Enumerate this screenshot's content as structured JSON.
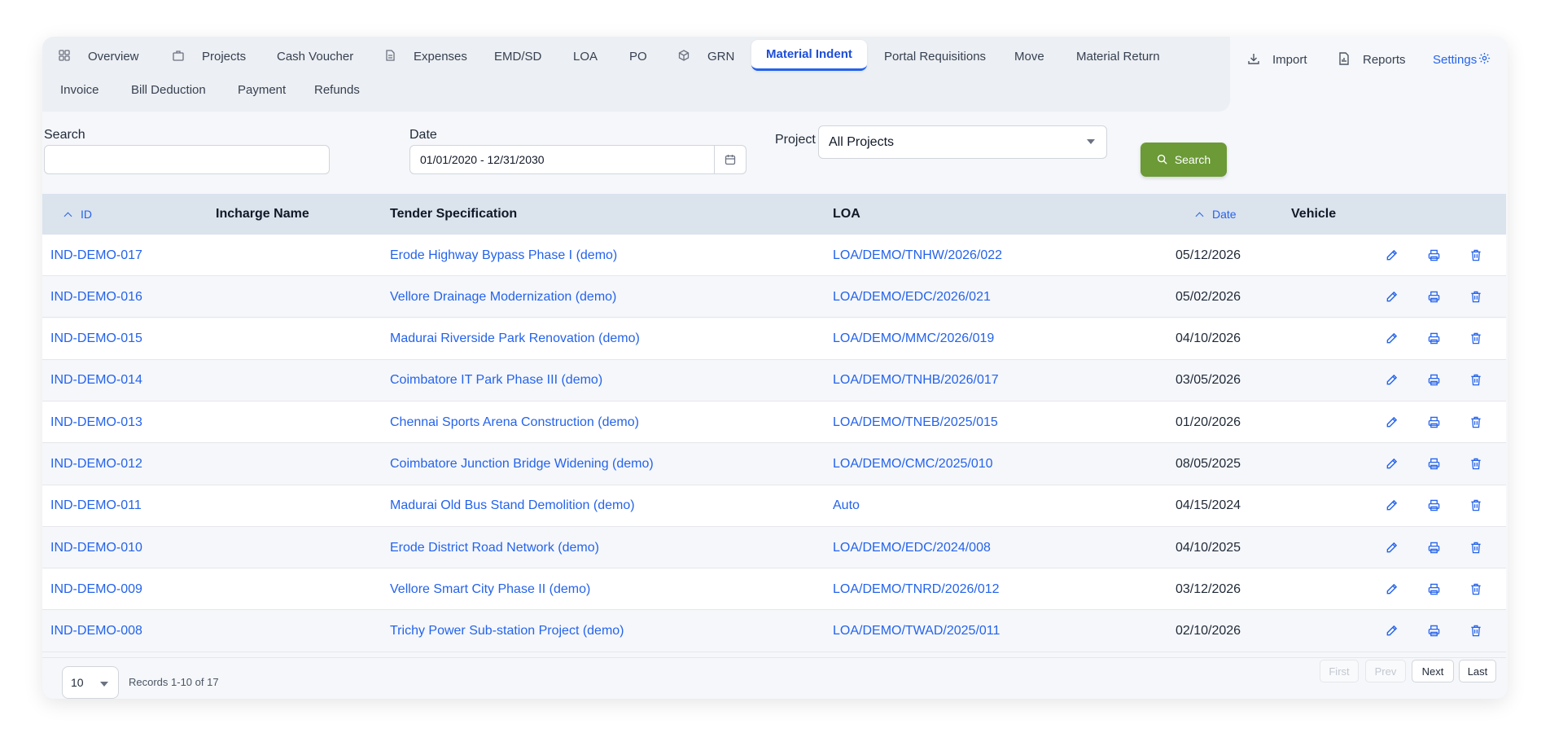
{
  "tabs": [
    {
      "label": "Overview",
      "icon": "grid-icon"
    },
    {
      "label": "Projects",
      "icon": "briefcase-icon"
    },
    {
      "label": "Cash Voucher",
      "icon": ""
    },
    {
      "label": "Expenses",
      "icon": "document-icon"
    },
    {
      "label": "EMD/SD",
      "icon": ""
    },
    {
      "label": "LOA",
      "icon": ""
    },
    {
      "label": "PO",
      "icon": ""
    },
    {
      "label": "GRN",
      "icon": "cube-icon"
    },
    {
      "label": "Material Indent",
      "icon": "",
      "active": true
    },
    {
      "label": "Portal Requisitions",
      "icon": ""
    },
    {
      "label": "Move",
      "icon": ""
    },
    {
      "label": "Material Return",
      "icon": ""
    },
    {
      "label": "Invoice",
      "icon": ""
    },
    {
      "label": "Bill Deduction",
      "icon": ""
    },
    {
      "label": "Payment",
      "icon": ""
    },
    {
      "label": "Refunds",
      "icon": ""
    }
  ],
  "tools": {
    "import_label": "Import",
    "reports_label": "Reports",
    "settings_label": "Settings"
  },
  "filters": {
    "search_label": "Search",
    "search_value": "",
    "date_label": "Date",
    "date_value": "01/01/2020 - 12/31/2030",
    "project_label": "Project",
    "project_value": "All Projects",
    "search_button": "Search"
  },
  "table": {
    "headers": {
      "id": "ID",
      "incharge": "Incharge Name",
      "tender": "Tender Specification",
      "loa": "LOA",
      "date": "Date",
      "vehicle": "Vehicle"
    },
    "rows": [
      {
        "id": "IND-DEMO-017",
        "incharge": "",
        "tender": "Erode Highway Bypass Phase I (demo)",
        "loa": "LOA/DEMO/TNHW/2026/022",
        "date": "05/12/2026",
        "vehicle": ""
      },
      {
        "id": "IND-DEMO-016",
        "incharge": "",
        "tender": "Vellore Drainage Modernization (demo)",
        "loa": "LOA/DEMO/EDC/2026/021",
        "date": "05/02/2026",
        "vehicle": ""
      },
      {
        "id": "IND-DEMO-015",
        "incharge": "",
        "tender": "Madurai Riverside Park Renovation (demo)",
        "loa": "LOA/DEMO/MMC/2026/019",
        "date": "04/10/2026",
        "vehicle": ""
      },
      {
        "id": "IND-DEMO-014",
        "incharge": "",
        "tender": "Coimbatore IT Park Phase III (demo)",
        "loa": "LOA/DEMO/TNHB/2026/017",
        "date": "03/05/2026",
        "vehicle": ""
      },
      {
        "id": "IND-DEMO-013",
        "incharge": "",
        "tender": "Chennai Sports Arena Construction (demo)",
        "loa": "LOA/DEMO/TNEB/2025/015",
        "date": "01/20/2026",
        "vehicle": ""
      },
      {
        "id": "IND-DEMO-012",
        "incharge": "",
        "tender": "Coimbatore Junction Bridge Widening (demo)",
        "loa": "LOA/DEMO/CMC/2025/010",
        "date": "08/05/2025",
        "vehicle": ""
      },
      {
        "id": "IND-DEMO-011",
        "incharge": "",
        "tender": "Madurai Old Bus Stand Demolition (demo)",
        "loa": "Auto",
        "date": "04/15/2024",
        "vehicle": ""
      },
      {
        "id": "IND-DEMO-010",
        "incharge": "",
        "tender": "Erode District Road Network (demo)",
        "loa": "LOA/DEMO/EDC/2024/008",
        "date": "04/10/2025",
        "vehicle": ""
      },
      {
        "id": "IND-DEMO-009",
        "incharge": "",
        "tender": "Vellore Smart City Phase II (demo)",
        "loa": "LOA/DEMO/TNRD/2026/012",
        "date": "03/12/2026",
        "vehicle": ""
      },
      {
        "id": "IND-DEMO-008",
        "incharge": "",
        "tender": "Trichy Power Sub-station Project (demo)",
        "loa": "LOA/DEMO/TWAD/2025/011",
        "date": "02/10/2026",
        "vehicle": ""
      }
    ]
  },
  "pagination": {
    "page_size": "10",
    "records_text": "Records 1-10 of 17",
    "first": "First",
    "prev": "Prev",
    "next": "Next",
    "last": "Last"
  },
  "colors": {
    "accent": "#2563eb",
    "search_button": "#6b9a37",
    "header_bg": "#dbe3ed"
  }
}
